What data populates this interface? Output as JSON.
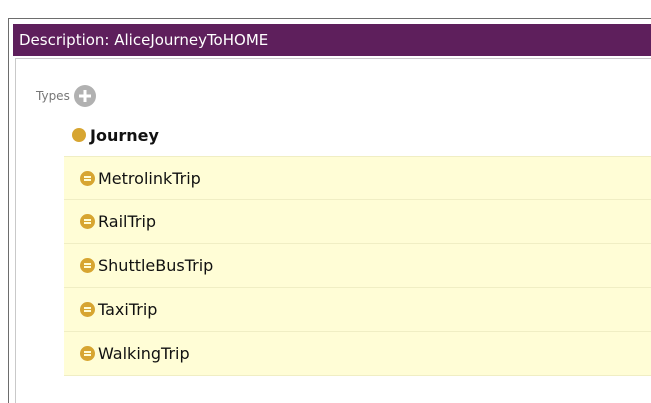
{
  "window": {
    "title": "Description: AliceJourneyToHOME"
  },
  "types": {
    "label": "Types",
    "add_icon": "plus-circle-icon",
    "asserted": [
      {
        "label": "Journey",
        "icon": "class-dot-icon"
      }
    ],
    "inferred": [
      {
        "label": "MetrolinkTrip",
        "icon": "inferred-class-icon"
      },
      {
        "label": "RailTrip",
        "icon": "inferred-class-icon"
      },
      {
        "label": "ShuttleBusTrip",
        "icon": "inferred-class-icon"
      },
      {
        "label": "TaxiTrip",
        "icon": "inferred-class-icon"
      },
      {
        "label": "WalkingTrip",
        "icon": "inferred-class-icon"
      }
    ]
  },
  "colors": {
    "titlebar": "#5e1f5c",
    "inferred_bg": "#fffdd6",
    "class_icon": "#d7a531"
  }
}
